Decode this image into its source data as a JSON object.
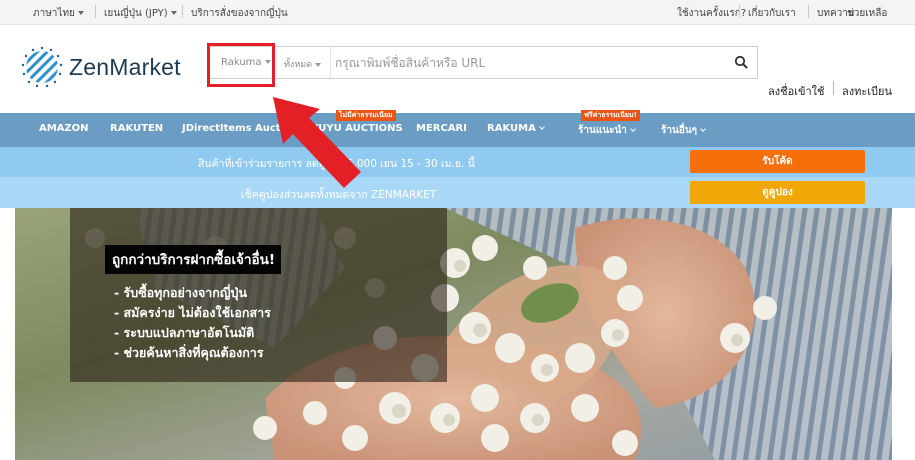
{
  "topbar": {
    "language": "ภาษาไทย",
    "currency": "เยนญี่ปุ่น (JPY)",
    "service": "บริการสั่งของจากญี่ปุ่น",
    "links": [
      "ใช้งานครั้งแรก?",
      "เกี่ยวกับเรา",
      "บทความ",
      "ช่วยเหลือ"
    ]
  },
  "header": {
    "logo_text": "ZenMarket",
    "search": {
      "store_selected": "Rakuma",
      "category_selected": "ทั้งหมด",
      "placeholder": "กรุณาพิมพ์ชื่อสินค้าหรือ URL"
    },
    "login": "ลงชื่อเข้าใช้",
    "register": "ลงทะเบียน"
  },
  "nav": {
    "items": [
      "AMAZON",
      "RAKUTEN",
      "JDirectItems Auction",
      "YUYU AUCTIONS",
      "MERCARI",
      "RAKUMA",
      "ร้านแนะนำ",
      "ร้านอื่นๆ"
    ],
    "tags": [
      "ไม่มีค่าธรรมเนียม",
      "ฟรีค่าธรรมเนียม!"
    ]
  },
  "promo": {
    "line1": "สินค้าที่เข้าร่วมรายการ ลดสูงสุด 5,000 เยน 15 - 30 เม.ย. นี้",
    "button1": "รับโค้ด",
    "line2": "เช็คคูปองส่วนลดทั้งหมดจาก ZENMARKET",
    "button2": "ดูคูปอง"
  },
  "hero": {
    "title": "ถูกกว่าบริการฝากซื้อเจ้าอื่น!",
    "bullets": [
      "- รับซื้อทุกอย่างจากญี่ปุ่น",
      "- สมัครง่าย ไม่ต้องใช้เอกสาร",
      "- ระบบแปลภาษาอัตโนมัติ",
      "- ช่วยค้นหาสิ่งที่คุณต้องการ"
    ]
  },
  "colors": {
    "nav": "#6a9cc4",
    "promo1": "#90caf0",
    "promo2": "#a9d8f6",
    "button_orange": "#f5700a",
    "button_amber": "#f0a707",
    "highlight_red": "#e32026"
  },
  "icons": [
    "zenmarket-logo-icon",
    "search-icon",
    "chevron-down-icon",
    "red-arrow-icon"
  ]
}
